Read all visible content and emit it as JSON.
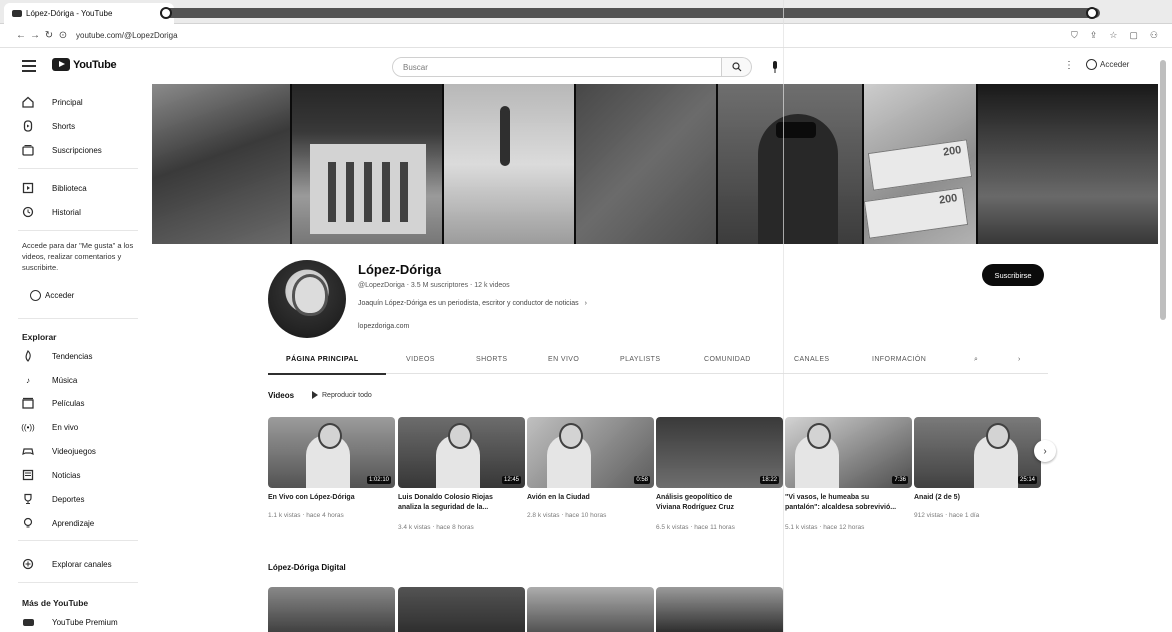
{
  "browser": {
    "tab_title": "López-Dóriga - YouTube",
    "url": "youtube.com/@LopezDoriga"
  },
  "header": {
    "search_placeholder": "Buscar",
    "signin_label": "Acceder"
  },
  "sidebar": {
    "items": [
      {
        "label": "Principal",
        "icon": "home-icon"
      },
      {
        "label": "Shorts",
        "icon": "shorts-icon"
      },
      {
        "label": "Suscripciones",
        "icon": "subscriptions-icon"
      },
      {
        "label": "Biblioteca",
        "icon": "library-icon"
      },
      {
        "label": "Historial",
        "icon": "history-icon"
      }
    ],
    "signin_note": "Accede para dar \"Me gusta\" a los videos, realizar comentarios y suscribirte.",
    "signin_label": "Acceder",
    "explore_heading": "Explorar",
    "explore": [
      {
        "label": "Tendencias",
        "icon": "trending-icon"
      },
      {
        "label": "Música",
        "icon": "music-icon"
      },
      {
        "label": "Películas",
        "icon": "movies-icon"
      },
      {
        "label": "En vivo",
        "icon": "live-icon"
      },
      {
        "label": "Videojuegos",
        "icon": "gaming-icon"
      },
      {
        "label": "Noticias",
        "icon": "news-icon"
      },
      {
        "label": "Deportes",
        "icon": "sports-icon"
      },
      {
        "label": "Aprendizaje",
        "icon": "learning-icon"
      }
    ],
    "browse_channels": "Explorar canales",
    "more_heading": "Más de YouTube",
    "premium": "YouTube Premium"
  },
  "channel": {
    "name": "López-Dóriga",
    "meta": "@LopezDoriga  ‧  3.5 M suscriptores  ‧  12 k videos",
    "description": "Joaquín López-Dóriga es un periodista, escritor y conductor de noticias",
    "link": "lopezdoriga.com",
    "subscribe": "Suscribirse"
  },
  "tabs": [
    "PÁGINA PRINCIPAL",
    "VIDEOS",
    "SHORTS",
    "EN VIVO",
    "PLAYLISTS",
    "COMUNIDAD",
    "CANALES",
    "INFORMACIÓN"
  ],
  "shelf": {
    "title": "Videos",
    "play_all": "Reproducir todo",
    "videos": [
      {
        "title": "En Vivo con López-Dóriga",
        "line2": "",
        "meta": "1.1 k vistas  ‧  hace 4 horas",
        "duration": "1:02:10"
      },
      {
        "title": "Luis Donaldo Colosio Riojas",
        "line2": "analiza la seguridad de la...",
        "meta": "3.4 k vistas  ‧  hace 8 horas",
        "duration": "12:45"
      },
      {
        "title": "Avión en la Ciudad",
        "line2": "",
        "meta": "2.8 k vistas  ‧  hace 10 horas",
        "duration": "0:58"
      },
      {
        "title": "Análisis geopolítico de",
        "line2": "Viviana Rodríguez Cruz",
        "meta": "6.5 k vistas  ‧  hace 11 horas",
        "duration": "18:22"
      },
      {
        "title": "\"Vi vasos, le humeaba su",
        "line2": "pantalón\": alcaldesa sobrevivió...",
        "meta": "5.1 k vistas  ‧  hace 12 horas",
        "duration": "7:36"
      },
      {
        "title": "Anaid (2 de 5)",
        "line2": "",
        "meta": "912 vistas  ‧  hace 1 día",
        "duration": "25:14"
      }
    ]
  },
  "shelf2": {
    "title": "López-Dóriga Digital"
  },
  "banner": {
    "bill_value": "200"
  }
}
